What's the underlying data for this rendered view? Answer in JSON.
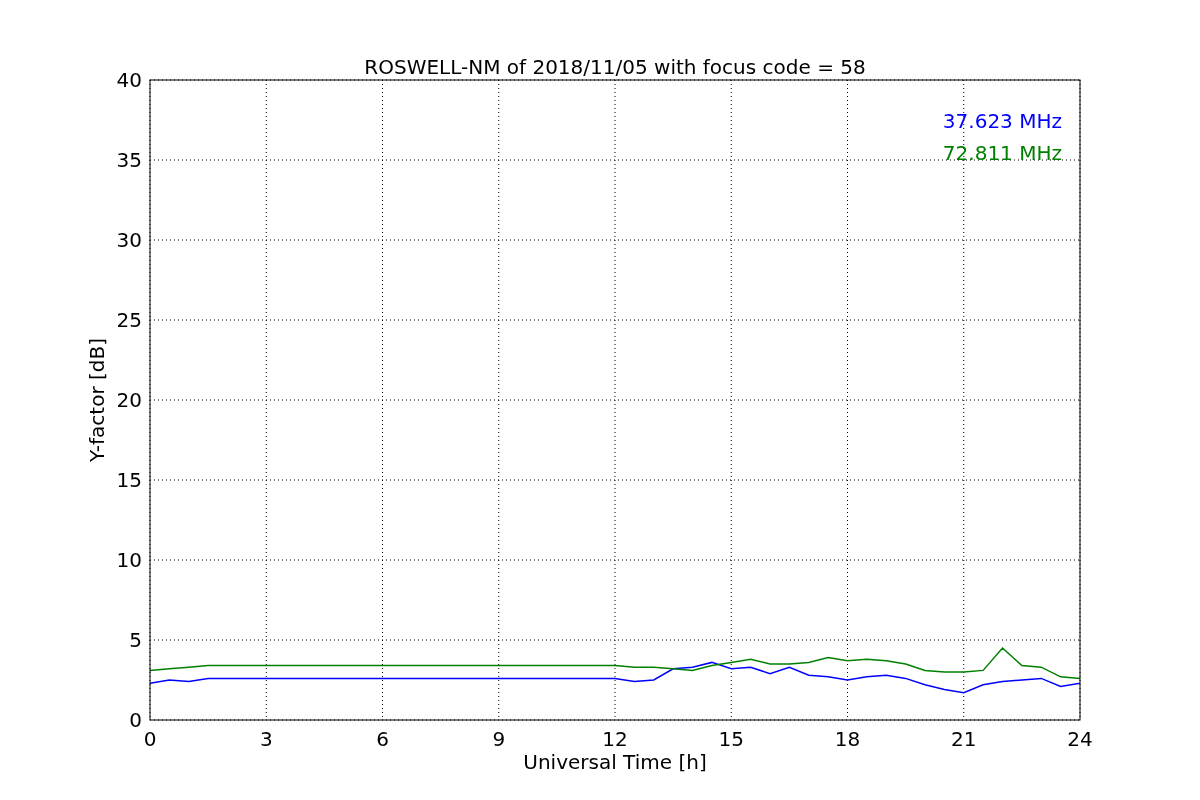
{
  "chart_data": {
    "type": "line",
    "title": "ROSWELL-NM of 2018/11/05 with focus code = 58",
    "xlabel": "Universal Time [h]",
    "ylabel": "Y-factor [dB]",
    "x": [
      0,
      0.5,
      1,
      1.5,
      2,
      2.5,
      3,
      3.5,
      4,
      4.5,
      5,
      5.5,
      6,
      6.5,
      7,
      7.5,
      8,
      8.5,
      9,
      9.5,
      10,
      10.5,
      11,
      11.5,
      12,
      12.5,
      13,
      13.5,
      14,
      14.5,
      15,
      15.5,
      16,
      16.5,
      17,
      17.5,
      18,
      18.5,
      19,
      19.5,
      20,
      20.5,
      21,
      21.5,
      22,
      22.5,
      23,
      23.5,
      24
    ],
    "series": [
      {
        "name": "37.623 MHz",
        "color": "#0000ff",
        "values": [
          2.3,
          2.5,
          2.4,
          2.6,
          2.6,
          2.6,
          2.6,
          2.6,
          2.6,
          2.6,
          2.6,
          2.6,
          2.6,
          2.6,
          2.6,
          2.6,
          2.6,
          2.6,
          2.6,
          2.6,
          2.6,
          2.6,
          2.6,
          2.6,
          2.6,
          2.4,
          2.5,
          3.2,
          3.3,
          3.6,
          3.2,
          3.3,
          2.9,
          3.3,
          2.8,
          2.7,
          2.5,
          2.7,
          2.8,
          2.6,
          2.2,
          1.9,
          1.7,
          2.2,
          2.4,
          2.5,
          2.6,
          2.1,
          2.3
        ]
      },
      {
        "name": "72.811 MHz",
        "color": "#008000",
        "values": [
          3.1,
          3.2,
          3.3,
          3.4,
          3.4,
          3.4,
          3.4,
          3.4,
          3.4,
          3.4,
          3.4,
          3.4,
          3.4,
          3.4,
          3.4,
          3.4,
          3.4,
          3.4,
          3.4,
          3.4,
          3.4,
          3.4,
          3.4,
          3.4,
          3.4,
          3.3,
          3.3,
          3.2,
          3.1,
          3.4,
          3.6,
          3.8,
          3.5,
          3.5,
          3.6,
          3.9,
          3.7,
          3.8,
          3.7,
          3.5,
          3.1,
          3.0,
          3.0,
          3.1,
          4.5,
          3.4,
          3.3,
          2.7,
          2.6
        ]
      }
    ],
    "grid": true,
    "xlim": [
      0,
      24
    ],
    "ylim": [
      0,
      40
    ],
    "xticks": [
      0,
      3,
      6,
      9,
      12,
      15,
      18,
      21,
      24
    ],
    "yticks": [
      0,
      5,
      10,
      15,
      20,
      25,
      30,
      35,
      40
    ]
  }
}
